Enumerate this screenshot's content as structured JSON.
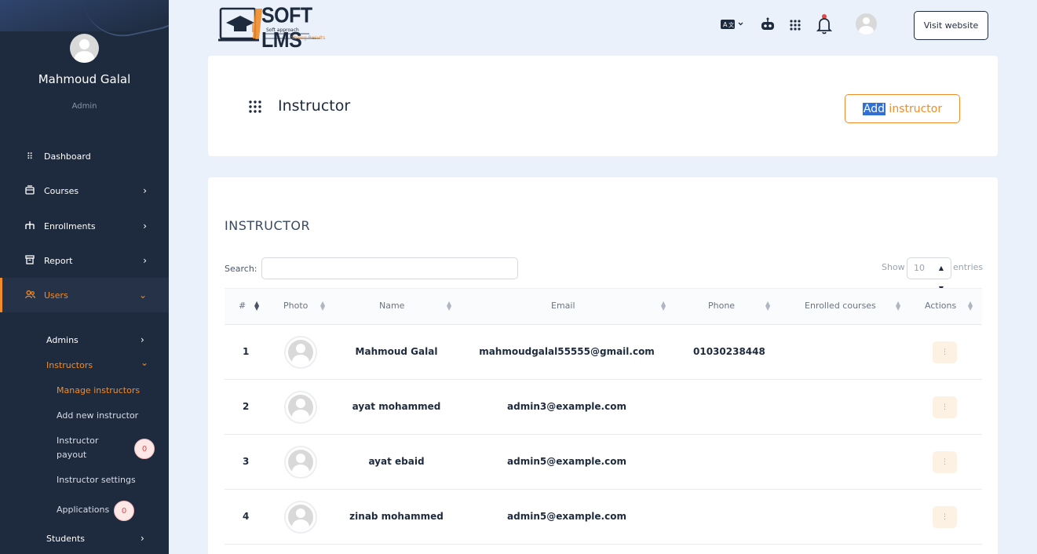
{
  "sidebar": {
    "user_name": "Mahmoud Galal",
    "user_role": "Admin",
    "nav": [
      {
        "label": "Dashboard",
        "icon": "dashboard-icon"
      },
      {
        "label": "Courses",
        "icon": "courses-icon"
      },
      {
        "label": "Enrollments",
        "icon": "enrollments-icon"
      },
      {
        "label": "Report",
        "icon": "report-icon"
      },
      {
        "label": "Users",
        "icon": "users-icon"
      }
    ],
    "users_sub": {
      "admins": "Admins",
      "instructors": "Instructors",
      "manage_instructors": "Manage instructors",
      "add_new_instructor": "Add new instructor",
      "instructor_payout_line1": "Instructor",
      "instructor_payout_line2": "payout",
      "instructor_payout_count": "0",
      "instructor_settings": "Instructor settings",
      "applications": "Applications",
      "applications_count": "0",
      "students": "Students"
    }
  },
  "header": {
    "logo_text": "SOFT LMS",
    "logo_tagline1": "Soft approach",
    "logo_tagline2": "Strong Results",
    "visit_website": "Visit website",
    "icons": [
      "language-icon",
      "robot-icon",
      "apps-grid-icon",
      "bell-icon"
    ]
  },
  "page": {
    "title": "Instructor",
    "add_button_selected": "Add",
    "add_button_rest": " instructor"
  },
  "table": {
    "section_title": "INSTRUCTOR",
    "search_label": "Search:",
    "search_value": "",
    "show_label": "Show",
    "entries_value": "10",
    "entries_label": "entries",
    "columns": [
      "#",
      "Photo",
      "Name",
      "Email",
      "Phone",
      "Enrolled courses",
      "Actions"
    ],
    "rows": [
      {
        "num": "1",
        "name": "Mahmoud Galal",
        "email": "mahmoudgalal55555@gmail.com",
        "phone": "01030238448",
        "enrolled": "",
        "action": "⋮"
      },
      {
        "num": "2",
        "name": "ayat mohammed",
        "email": "admin3@example.com",
        "phone": "",
        "enrolled": "",
        "action": "⋮"
      },
      {
        "num": "3",
        "name": "ayat ebaid",
        "email": "admin5@example.com",
        "phone": "",
        "enrolled": "",
        "action": "⋮"
      },
      {
        "num": "4",
        "name": "zinab mohammed",
        "email": "admin5@example.com",
        "phone": "",
        "enrolled": "",
        "action": "⋮"
      }
    ]
  },
  "colors": {
    "sidebar_bg": "#1e2a3d",
    "accent": "#f28c28",
    "page_bg": "#eaf1fa"
  }
}
